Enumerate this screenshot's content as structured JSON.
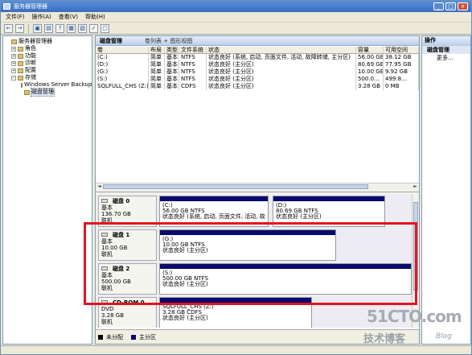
{
  "window": {
    "title": "服务器管理器"
  },
  "menu": [
    "文件(F)",
    "操作(A)",
    "查看(V)",
    "帮助(H)"
  ],
  "toolbar": [
    "←",
    "→",
    "▣",
    "▤",
    "?",
    "▦",
    "▧",
    "✓",
    "▢"
  ],
  "tree": [
    {
      "label": "服务器管理器",
      "indent": 0,
      "exp": ""
    },
    {
      "label": "角色",
      "indent": 1,
      "exp": "+"
    },
    {
      "label": "功能",
      "indent": 1,
      "exp": "+"
    },
    {
      "label": "诊断",
      "indent": 1,
      "exp": "+"
    },
    {
      "label": "配置",
      "indent": 1,
      "exp": "+"
    },
    {
      "label": "存储",
      "indent": 1,
      "exp": "−"
    },
    {
      "label": "Windows Server Backup",
      "indent": 2,
      "exp": ""
    },
    {
      "label": "磁盘管理",
      "indent": 2,
      "exp": "",
      "selected": true
    }
  ],
  "center": {
    "title": "磁盘管理",
    "views": "卷列表 + 图形视图"
  },
  "volumes": {
    "headers": [
      "卷",
      "布局",
      "类型",
      "文件系统",
      "状态",
      "容量",
      "可用空间"
    ],
    "rows": [
      [
        "(C:)",
        "简单",
        "基本",
        "NTFS",
        "状态良好 (系统, 启动, 页面文件, 活动, 故障转储, 主分区)",
        "56.00 GB",
        "38.12 GB"
      ],
      [
        "(D:)",
        "简单",
        "基本",
        "NTFS",
        "状态良好 (主分区)",
        "80.69 GB",
        "77.95 GB"
      ],
      [
        "(G:)",
        "简单",
        "基本",
        "NTFS",
        "状态良好 (主分区)",
        "10.00 GB",
        "9.92 GB"
      ],
      [
        "(S:)",
        "简单",
        "基本",
        "NTFS",
        "状态良好 (主分区)",
        "500.0…",
        "499.8…"
      ],
      [
        "SQLFULL_CHS (Z:)",
        "简单",
        "基本",
        "CDFS",
        "状态良好 (主分区)",
        "3.28 GB",
        "0 MB"
      ]
    ]
  },
  "disks": [
    {
      "name": "磁盘 0",
      "type": "基本",
      "size": "136.70 GB",
      "status": "联机",
      "parts": [
        {
          "lines": [
            "(C:)",
            "56.00 GB NTFS",
            "状态良好 (系统, 启动, 页面文件, 活动, 故"
          ]
        },
        {
          "lines": [
            "(D:)",
            "80.69 GB NTFS",
            "状态良好 (主分区)"
          ]
        }
      ]
    },
    {
      "name": "磁盘 1",
      "type": "基本",
      "size": "10.00 GB",
      "status": "联机",
      "parts": [
        {
          "lines": [
            "(G:)",
            "10.00 GB NTFS",
            "状态良好 (主分区)"
          ]
        }
      ]
    },
    {
      "name": "磁盘 2",
      "type": "基本",
      "size": "500.00 GB",
      "status": "联机",
      "parts": [
        {
          "lines": [
            "(S:)",
            "500.00 GB NTFS",
            "状态良好 (主分区)"
          ]
        }
      ]
    },
    {
      "name": "CD-ROM 0",
      "type": "DVD",
      "size": "3.28 GB",
      "status": "联机",
      "parts": [
        {
          "lines": [
            "SQLFULL_CHS (Z:)",
            "3.28 GB CDFS",
            "状态良好 (主分区)"
          ]
        }
      ]
    }
  ],
  "legend": [
    {
      "label": "未分配",
      "color": "#000000"
    },
    {
      "label": "主分区",
      "color": "#0a0a6e"
    }
  ],
  "actions": {
    "header": "操作",
    "section": "磁盘管理",
    "more": "更多..."
  },
  "watermark": {
    "site": "51CTO.com",
    "blog": "技术博客",
    "blog_en": "Blog"
  }
}
